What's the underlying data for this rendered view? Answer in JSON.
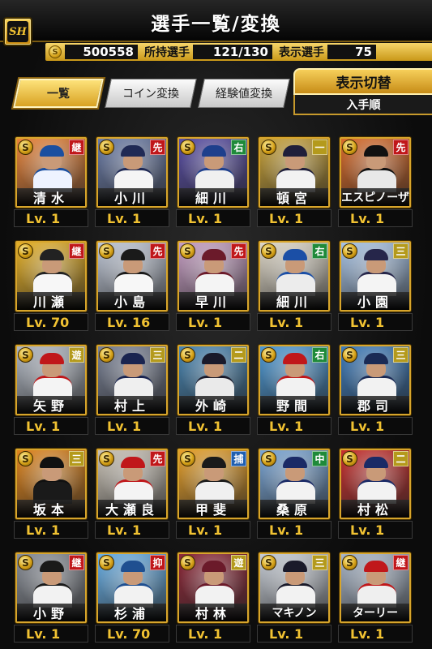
{
  "header": {
    "title": "選手一覧/変換",
    "logo_text": "SH"
  },
  "stats": {
    "coins": "500558",
    "owned_label": "所持選手",
    "owned_value": "121/130",
    "shown_label": "表示選手",
    "shown_value": "75"
  },
  "tabs": [
    {
      "label": "一覧",
      "active": true
    },
    {
      "label": "コイン変換",
      "active": false
    },
    {
      "label": "経験値変換",
      "active": false
    }
  ],
  "display_switch": {
    "label": "表示切替",
    "sort": "入手順"
  },
  "coin_symbol": "S",
  "players": [
    {
      "name": "清水",
      "level": "Lv. 1",
      "pos": "継",
      "pos_color": "#c0171a",
      "bg": "#e8843a",
      "uniform": "#eef3ff",
      "cap": "#1a4fa0"
    },
    {
      "name": "小川",
      "level": "Lv. 1",
      "pos": "先",
      "pos_color": "#c0171a",
      "bg": "#6c7da8",
      "uniform": "#f5f5f5",
      "cap": "#202a55"
    },
    {
      "name": "細川",
      "level": "Lv. 1",
      "pos": "右",
      "pos_color": "#1f8a3a",
      "bg": "#5a4fa6",
      "uniform": "#f0f0f0",
      "cap": "#1e3f8c"
    },
    {
      "name": "頓宮",
      "level": "Lv. 1",
      "pos": "一",
      "pos_color": "#b49a1c",
      "bg": "#c9a33a",
      "uniform": "#f2f2f2",
      "cap": "#1f1f3a"
    },
    {
      "name": "エスピノーザ",
      "level": "Lv. 1",
      "pos": "先",
      "pos_color": "#c0171a",
      "bg": "#d96c2b",
      "uniform": "#e8e8e8",
      "cap": "#111111"
    },
    {
      "name": "川瀬",
      "level": "Lv. 70",
      "pos": "継",
      "pos_color": "#c0171a",
      "bg": "#e6b128",
      "uniform": "#f7f7f7",
      "cap": "#222222"
    },
    {
      "name": "小島",
      "level": "Lv. 16",
      "pos": "先",
      "pos_color": "#c0171a",
      "bg": "#bfc7d6",
      "uniform": "#f7f7f7",
      "cap": "#1a1a1a"
    },
    {
      "name": "早川",
      "level": "Lv. 1",
      "pos": "先",
      "pos_color": "#c0171a",
      "bg": "#c79fc4",
      "uniform": "#f4f4f4",
      "cap": "#6b1a2a"
    },
    {
      "name": "細川",
      "level": "Lv. 1",
      "pos": "右",
      "pos_color": "#1f8a3a",
      "bg": "#e0d9c9",
      "uniform": "#ececec",
      "cap": "#1b4fa6"
    },
    {
      "name": "小園",
      "level": "Lv. 1",
      "pos": "三",
      "pos_color": "#b49a1c",
      "bg": "#a8c4e6",
      "uniform": "#f4f4f4",
      "cap": "#26264a"
    },
    {
      "name": "矢野",
      "level": "Lv. 1",
      "pos": "遊",
      "pos_color": "#b49a1c",
      "bg": "#b0b7c2",
      "uniform": "#f4f4f4",
      "cap": "#c0171a"
    },
    {
      "name": "村上",
      "level": "Lv. 1",
      "pos": "三",
      "pos_color": "#b49a1c",
      "bg": "#7a8296",
      "uniform": "#efefef",
      "cap": "#1a2450"
    },
    {
      "name": "外崎",
      "level": "Lv. 1",
      "pos": "二",
      "pos_color": "#b49a1c",
      "bg": "#4a87b4",
      "uniform": "#eaeaea",
      "cap": "#1a1a2a"
    },
    {
      "name": "野間",
      "level": "Lv. 1",
      "pos": "右",
      "pos_color": "#1f8a3a",
      "bg": "#4e9ad6",
      "uniform": "#f2f2f2",
      "cap": "#c0171a"
    },
    {
      "name": "郡司",
      "level": "Lv. 1",
      "pos": "三",
      "pos_color": "#b49a1c",
      "bg": "#3f7dbd",
      "uniform": "#f2f2f2",
      "cap": "#1a2a55"
    },
    {
      "name": "坂本",
      "level": "Lv. 1",
      "pos": "三",
      "pos_color": "#b49a1c",
      "bg": "#e0861f",
      "uniform": "#1a1a1a",
      "cap": "#111111"
    },
    {
      "name": "大瀬良",
      "level": "Lv. 1",
      "pos": "先",
      "pos_color": "#c0171a",
      "bg": "#c9c2b6",
      "uniform": "#f4f4f4",
      "cap": "#c0171a"
    },
    {
      "name": "甲斐",
      "level": "Lv. 1",
      "pos": "捕",
      "pos_color": "#1f5fb0",
      "bg": "#e6a02c",
      "uniform": "#f0f0f0",
      "cap": "#1a1a1a"
    },
    {
      "name": "桑原",
      "level": "Lv. 1",
      "pos": "中",
      "pos_color": "#1f8a3a",
      "bg": "#7aa6d6",
      "uniform": "#f2f2f2",
      "cap": "#1a2a66"
    },
    {
      "name": "村松",
      "level": "Lv. 1",
      "pos": "二",
      "pos_color": "#b49a1c",
      "bg": "#c7312f",
      "uniform": "#f2f2f2",
      "cap": "#1a2a66"
    },
    {
      "name": "小野",
      "level": "Lv. 1",
      "pos": "継",
      "pos_color": "#c0171a",
      "bg": "#8a8f98",
      "uniform": "#f2f2f2",
      "cap": "#1a1a1a"
    },
    {
      "name": "杉浦",
      "level": "Lv. 70",
      "pos": "抑",
      "pos_color": "#c0171a",
      "bg": "#6ab0e6",
      "uniform": "#f2f2f2",
      "cap": "#1f4f90"
    },
    {
      "name": "村林",
      "level": "Lv. 1",
      "pos": "遊",
      "pos_color": "#b49a1c",
      "bg": "#8e2a3a",
      "uniform": "#f2f2f2",
      "cap": "#6b1a2a"
    },
    {
      "name": "マキノン",
      "level": "Lv. 1",
      "pos": "三",
      "pos_color": "#b49a1c",
      "bg": "#c7cdd6",
      "uniform": "#f2f2f2",
      "cap": "#1a1a2a"
    },
    {
      "name": "ターリー",
      "level": "Lv. 1",
      "pos": "継",
      "pos_color": "#c0171a",
      "bg": "#a9b6c8",
      "uniform": "#efefef",
      "cap": "#c0171a"
    }
  ]
}
